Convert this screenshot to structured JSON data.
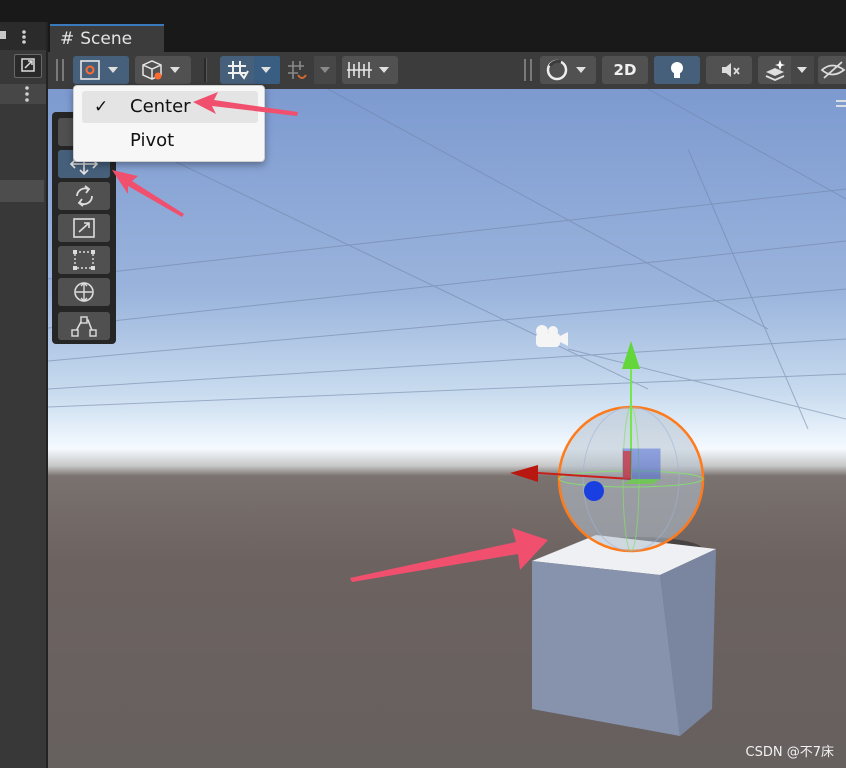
{
  "tab": {
    "scene_label": "Scene",
    "hash_glyph": "#"
  },
  "toolbar": {
    "two_d_label": "2D",
    "accent": "#46607c"
  },
  "pivot_dropdown": {
    "items": [
      {
        "label": "Center",
        "checked": true,
        "check_glyph": "✓"
      },
      {
        "label": "Pivot",
        "checked": false
      }
    ]
  },
  "tools": [
    {
      "name": "view-tool",
      "icon": "hand-icon"
    },
    {
      "name": "move-tool",
      "icon": "move-icon",
      "active": true
    },
    {
      "name": "rotate-tool",
      "icon": "rotate-icon"
    },
    {
      "name": "scale-tool",
      "icon": "scale-icon"
    },
    {
      "name": "rect-tool",
      "icon": "rect-icon"
    },
    {
      "name": "transform-tool",
      "icon": "transform-icon"
    },
    {
      "name": "custom-tool",
      "icon": "custom-tool-icon"
    }
  ],
  "watermark": "CSDN @不7床",
  "colors": {
    "annotation_arrow": "#f0506e",
    "selection_outline": "#ff7a1a",
    "gizmo_y": "#74e84a",
    "gizmo_x": "#c8201a",
    "gizmo_z": "#1a3fe0"
  }
}
